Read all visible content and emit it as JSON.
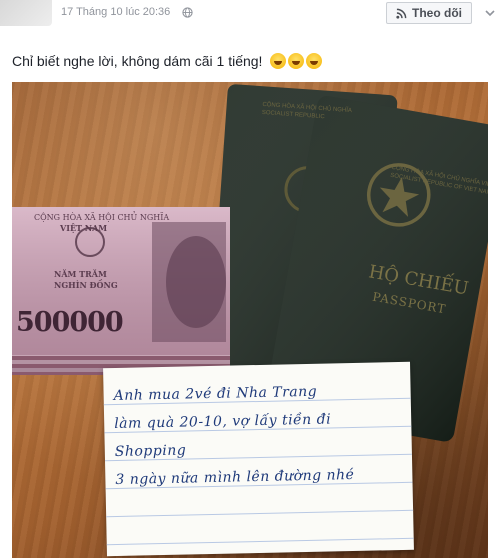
{
  "post": {
    "timestamp": "17 Tháng 10 lúc 20:36",
    "follow_label": "Theo dõi",
    "text": "Chỉ biết nghe lời, không dám cãi 1 tiếng!"
  },
  "photo": {
    "banknote": {
      "line1": "CỘNG HÒA XÃ HỘI CHỦ NGHĨA",
      "line2": "VIỆT NAM",
      "denomination_words": "NĂM TRĂM\nNGHÌN ĐỒNG",
      "value": "500000"
    },
    "passport": {
      "back_header": "CỘNG HÒA XÃ HỘI CHỦ NGHĨA\nSOCIALIST REPUBLIC",
      "front_header": "CỘNG HÒA XÃ HỘI CHỦ NGHĨA VIỆT NAM\nSOCIALIST REPUBLIC OF VIET NAM",
      "title": "HỘ CHIẾU",
      "subtitle": "PASSPORT"
    },
    "note_lines": [
      "Anh mua 2vé đi Nha Trang",
      "làm quà 20-10, vợ lấy tiền đi",
      "Shopping",
      "3 ngày nữa mình lên đường nhé"
    ]
  },
  "icons": {
    "globe": "globe-icon",
    "rss": "rss-icon",
    "more": "chevron-down-icon",
    "emoji": "laughing-tears-emoji"
  }
}
